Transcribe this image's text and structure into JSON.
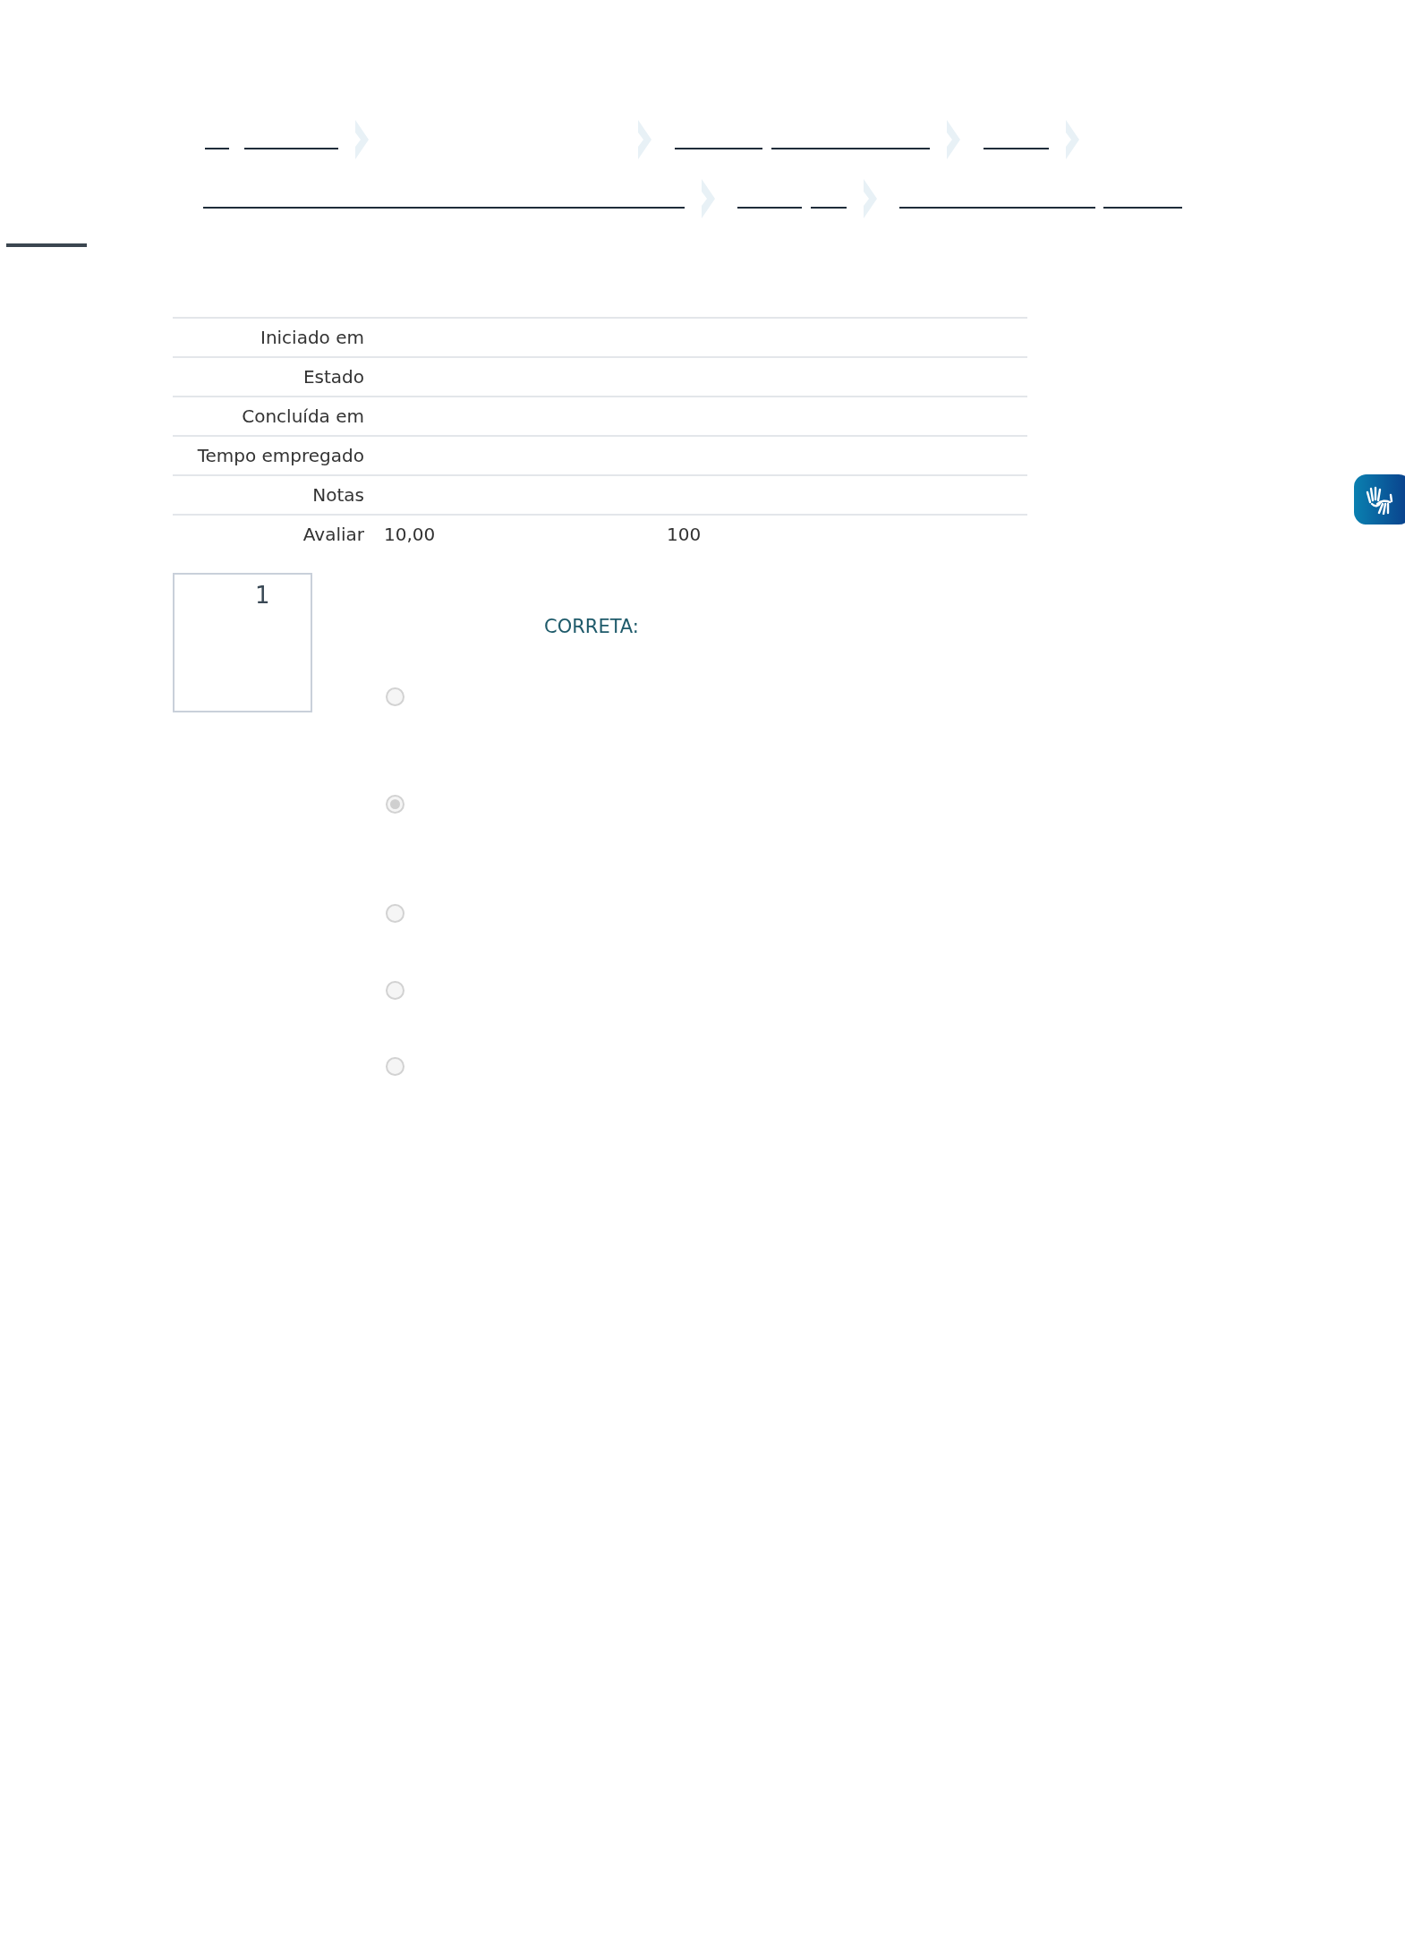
{
  "summary": {
    "rows": [
      {
        "label": "Iniciado em"
      },
      {
        "label": "Estado"
      },
      {
        "label": "Concluída em"
      },
      {
        "label": "Tempo empregado"
      },
      {
        "label": "Notas"
      },
      {
        "label": "Avaliar",
        "value": "10,00",
        "extra": "100"
      }
    ]
  },
  "question": {
    "number": "1",
    "correct_label": "CORRETA:",
    "options": [
      {
        "selected": false
      },
      {
        "selected": true
      },
      {
        "selected": false
      },
      {
        "selected": false
      },
      {
        "selected": false
      }
    ]
  }
}
